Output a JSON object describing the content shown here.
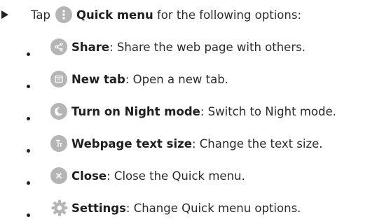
{
  "intro": {
    "prefix": "Tap",
    "menu_name": "Quick menu",
    "suffix": "for the following options:"
  },
  "options": [
    {
      "icon": "share-icon",
      "label": "Share",
      "desc": ": Share the web page with others."
    },
    {
      "icon": "new-tab-icon",
      "label": "New tab",
      "desc": ": Open a new tab."
    },
    {
      "icon": "night-mode-icon",
      "label": "Turn on Night mode",
      "desc": ": Switch to Night mode."
    },
    {
      "icon": "text-size-icon",
      "label": "Webpage text size",
      "desc": ": Change the text size."
    },
    {
      "icon": "close-icon",
      "label": "Close",
      "desc": ": Close the Quick menu."
    },
    {
      "icon": "settings-gear-icon",
      "label": "Settings",
      "desc": ": Change Quick menu options."
    }
  ],
  "colors": {
    "icon_bg": "#b5b5b5",
    "text": "#2b2b2b"
  }
}
